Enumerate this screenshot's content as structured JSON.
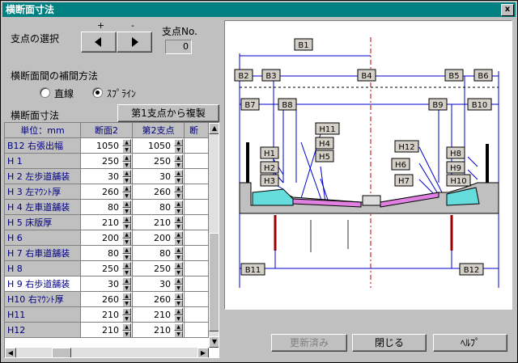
{
  "window": {
    "title": "横断面寸法",
    "close_glyph": "x"
  },
  "support": {
    "label": "支点の選択",
    "plus": "+",
    "minus": "-",
    "no_label": "支点No.",
    "no_value": "0"
  },
  "interp": {
    "label": "横断面間の補間方法",
    "linear": "直線",
    "spline": "ｽﾌﾟﾗｲﾝ"
  },
  "dims": {
    "label": "横断面寸法",
    "copy_button": "第1支点から複製"
  },
  "table": {
    "headers": [
      "単位：mm",
      "断面2",
      "第2支点",
      "断"
    ],
    "rows": [
      {
        "name": "B12 右張出幅",
        "v1": "1050",
        "v2": "1050"
      },
      {
        "name": "H 1",
        "v1": "250",
        "v2": "250"
      },
      {
        "name": "H 2 左歩道舗装",
        "v1": "30",
        "v2": "30"
      },
      {
        "name": "H 3 左ﾏｳﾝﾄ厚",
        "v1": "260",
        "v2": "260"
      },
      {
        "name": "H 4 左車道舗装",
        "v1": "80",
        "v2": "80"
      },
      {
        "name": "H 5 床版厚",
        "v1": "210",
        "v2": "210"
      },
      {
        "name": "H 6",
        "v1": "200",
        "v2": "200"
      },
      {
        "name": "H 7 右車道舗装",
        "v1": "80",
        "v2": "80"
      },
      {
        "name": "H 8",
        "v1": "250",
        "v2": "250"
      },
      {
        "name": "H 9 右歩道舗装",
        "v1": "30",
        "v2": "30"
      },
      {
        "name": "H10 右ﾏｳﾝﾄ厚",
        "v1": "260",
        "v2": "260"
      },
      {
        "name": "H11",
        "v1": "210",
        "v2": "210"
      },
      {
        "name": "H12",
        "v1": "210",
        "v2": "210"
      }
    ]
  },
  "drawing": {
    "labels": {
      "B1": "B1",
      "B2": "B2",
      "B3": "B3",
      "B4": "B4",
      "B5": "B5",
      "B6": "B6",
      "B7": "B7",
      "B8": "B8",
      "B9": "B9",
      "B10": "B10",
      "B11": "B11",
      "B12": "B12",
      "H1": "H1",
      "H2": "H2",
      "H3": "H3",
      "H4": "H4",
      "H5": "H5",
      "H6": "H6",
      "H7": "H7",
      "H8": "H8",
      "H9": "H9",
      "H10": "H10",
      "H11": "H11",
      "H12": "H12"
    }
  },
  "footer": {
    "updated": "更新済み",
    "close": "閉じる",
    "help": "ﾍﾙﾌﾟ"
  },
  "colors": {
    "title_bg": "#008080",
    "header_text": "#000080",
    "slab": "#c0c0c0",
    "mount": "#66dddd"
  }
}
